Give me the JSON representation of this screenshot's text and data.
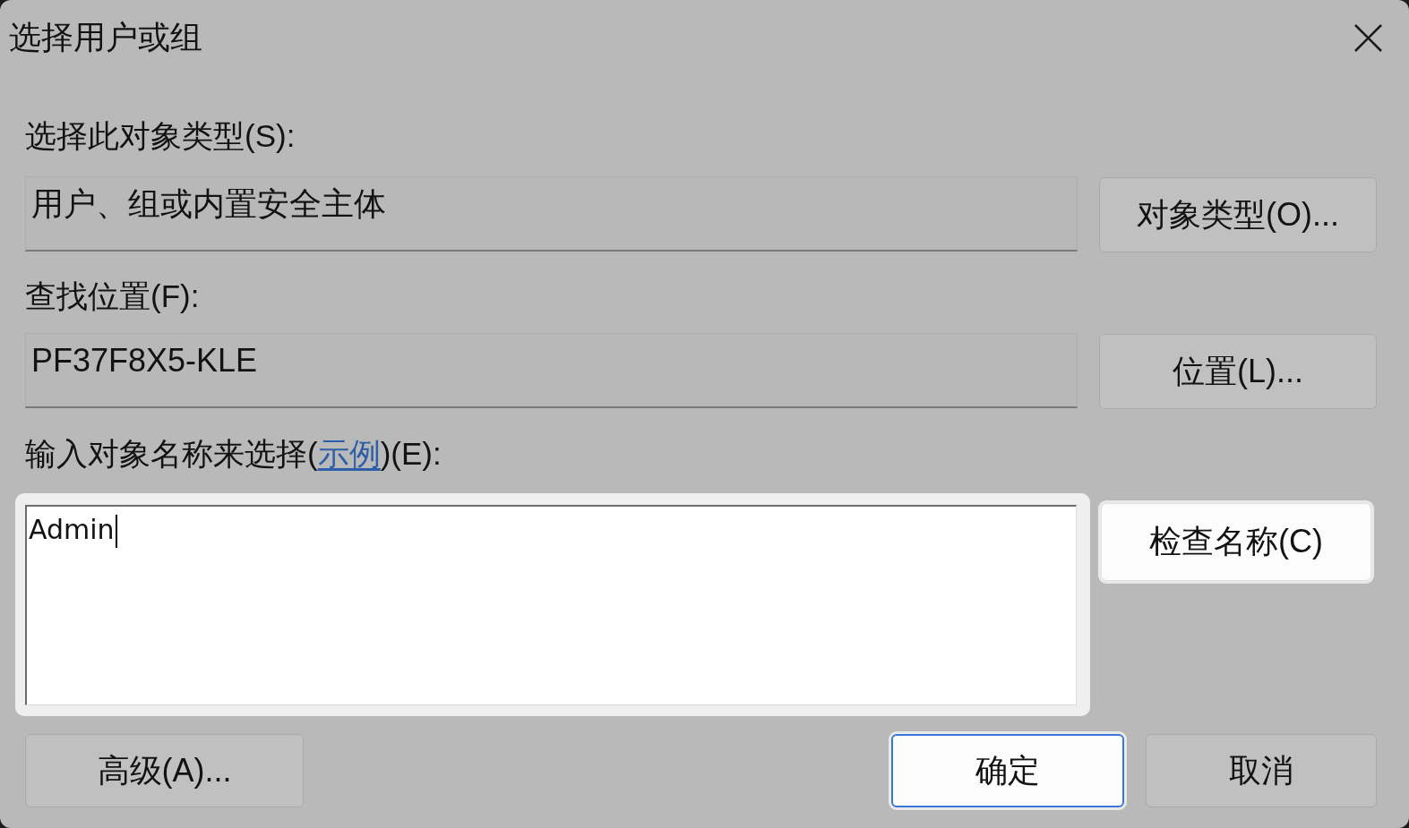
{
  "window": {
    "title": "选择用户或组"
  },
  "object_type": {
    "label": "选择此对象类型(S):",
    "value": "用户、组或内置安全主体",
    "button": {
      "label": "对象类型(O)...",
      "highlighted": false
    }
  },
  "location": {
    "label": "查找位置(F):",
    "value": "PF37F8X5-KLE",
    "button": {
      "label": "位置(L)...",
      "highlighted": false
    }
  },
  "object_names": {
    "label": {
      "before": "输入对象名称来选择(",
      "link": "示例",
      "after": ")(E):"
    },
    "value": "Admin",
    "focused": true,
    "highlighted": true,
    "button": {
      "label": "检查名称(C)",
      "highlighted": true
    }
  },
  "buttons": [
    {
      "label": "高级(A)...",
      "highlighted": false,
      "default": false
    },
    {
      "label": "确定",
      "highlighted": true,
      "default": true
    },
    {
      "label": "取消",
      "highlighted": false,
      "default": false
    }
  ]
}
